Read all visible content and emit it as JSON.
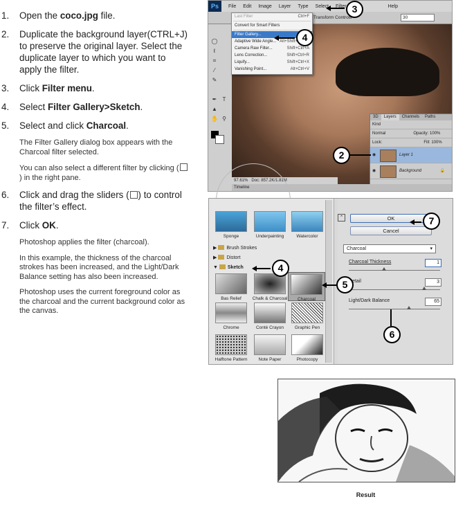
{
  "steps": [
    {
      "num": "1.",
      "pre": "Open the ",
      "bold": "coco.jpg",
      "post": " file."
    },
    {
      "num": "2.",
      "pre": "Duplicate the background layer(CTRL+J) to preserve the original layer. Select the duplicate layer to which you want to apply the filter.",
      "bold": "",
      "post": ""
    },
    {
      "num": "3.",
      "pre": "Click ",
      "bold": "Filter menu",
      "post": "."
    },
    {
      "num": "4.",
      "pre": "Select ",
      "bold": "Filter Gallery>Sketch",
      "post": "."
    },
    {
      "num": "5.",
      "pre": "Select and click ",
      "bold": "Charcoal",
      "post": "."
    },
    {
      "num": "6.",
      "pre": "Click and drag the sliders (",
      "bold": "",
      "post": ") to control the filter’s effect."
    },
    {
      "num": "7.",
      "pre": "Click ",
      "bold": "OK",
      "post": "."
    }
  ],
  "notes": {
    "step5_a": "The Filter Gallery dialog box appears with the Charcoal filter selected.",
    "step5_b_pre": "You can also select a different filter by clicking (",
    "step5_b_post": ") in the right pane.",
    "step7_a": "Photoshop applies the filter (charcoal).",
    "step7_b": "In this example, the thickness of the charcoal strokes has been increased, and the Light/Dark Balance setting has also been increased.",
    "step7_c": "Photoshop uses the current foreground color as the charcoal and the current background color as the canvas."
  },
  "photoshop": {
    "logo": "Ps",
    "menus": [
      "File",
      "Edit",
      "Image",
      "Layer",
      "Type",
      "Select",
      "Filter",
      "Help"
    ],
    "options_text": "Transform Controls",
    "zoom_field": "30",
    "filter_menu": [
      {
        "label": "Last Filter",
        "shortcut": "Ctrl+F",
        "state": "dim"
      },
      {
        "label": "Convert for Smart Filters",
        "shortcut": "",
        "state": ""
      },
      {
        "label": "Filter Gallery...",
        "shortcut": "",
        "state": "sel"
      },
      {
        "label": "Adaptive Wide Angle...",
        "shortcut": "Alt+Shift+Ctrl+A",
        "state": ""
      },
      {
        "label": "Camera Raw Filter...",
        "shortcut": "Shift+Ctrl+A",
        "state": ""
      },
      {
        "label": "Lens Correction...",
        "shortcut": "Shift+Ctrl+R",
        "state": ""
      },
      {
        "label": "Liquify...",
        "shortcut": "Shift+Ctrl+X",
        "state": ""
      },
      {
        "label": "Vanishing Point...",
        "shortcut": "Alt+Ctrl+V",
        "state": ""
      }
    ],
    "status_zoom": "97.61%",
    "status_doc": "Doc: 857.2K/1.81M",
    "timeline": "Timeline",
    "layers_panel": {
      "tabs": [
        "3D",
        "Layers",
        "Channels",
        "Paths"
      ],
      "kind": "Kind",
      "blend": "Normal",
      "opacity": "Opacity: 100%",
      "lock": "Lock:",
      "fill": "Fill: 100%",
      "layers": [
        {
          "name": "Layer 1",
          "selected": true
        },
        {
          "name": "Background",
          "selected": false
        }
      ]
    }
  },
  "filter_gallery": {
    "top_thumbs": [
      "Sponge",
      "Underpainting",
      "Watercolor"
    ],
    "folders": [
      "Brush Strokes",
      "Distort",
      "Sketch"
    ],
    "sketch_thumbs": [
      "Bas Relief",
      "Chalk & Charcoal",
      "Charcoal",
      "Chrome",
      "Conté Crayon",
      "Graphic Pen",
      "Halftone Pattern",
      "Note Paper",
      "Photocopy"
    ],
    "ok": "OK",
    "cancel": "Cancel",
    "filter_select": "Charcoal",
    "params": [
      {
        "label": "Charcoal Thickness",
        "value": "1"
      },
      {
        "label": "Detail",
        "value": "3"
      },
      {
        "label": "Light/Dark Balance",
        "value": "65"
      }
    ]
  },
  "callouts": [
    "3",
    "4",
    "2",
    "4",
    "5",
    "6",
    "7"
  ],
  "result_caption": "Result"
}
